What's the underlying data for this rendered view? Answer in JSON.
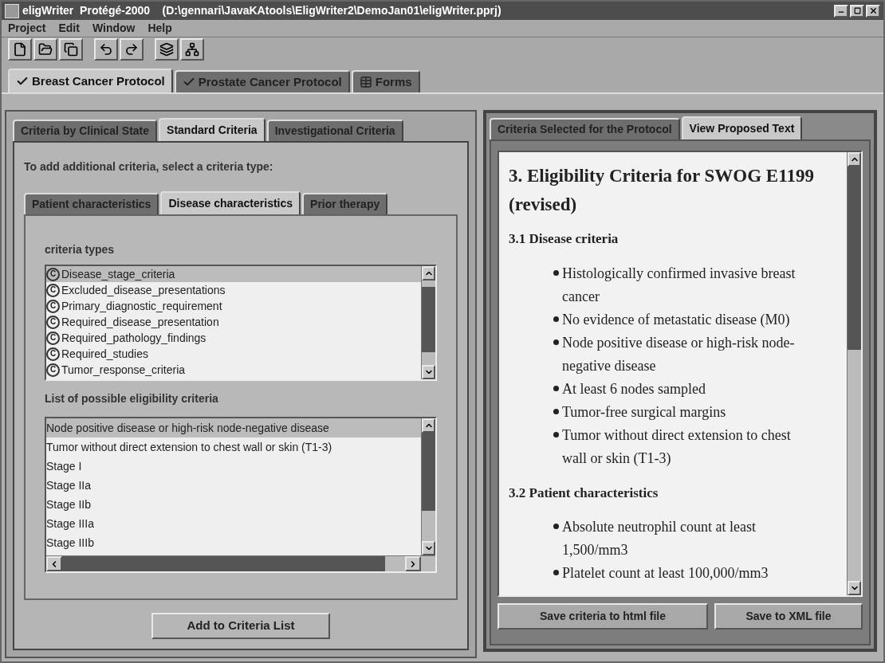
{
  "window": {
    "title": "eligWriter  Protégé-2000    (D:\\gennari\\JavaKAtools\\EligWriter2\\DemoJan01\\eligWriter.pprj)"
  },
  "menu": [
    "Project",
    "Edit",
    "Window",
    "Help"
  ],
  "protocol_tabs": [
    {
      "label": "Breast Cancer Protocol",
      "kind": "check",
      "selected": true
    },
    {
      "label": "Prostate Cancer Protocol",
      "kind": "check",
      "selected": false
    },
    {
      "label": "Forms",
      "kind": "form",
      "selected": false
    }
  ],
  "left_tabs": [
    {
      "label": "Criteria by Clinical State",
      "selected": false
    },
    {
      "label": "Standard Criteria",
      "selected": true
    },
    {
      "label": "Investigational Criteria",
      "selected": false
    }
  ],
  "instruction": "To add additional criteria, select a criteria type:",
  "type_tabs": [
    {
      "label": "Patient characteristics",
      "selected": false
    },
    {
      "label": "Disease characteristics",
      "selected": true
    },
    {
      "label": "Prior therapy",
      "selected": false
    }
  ],
  "criteria_types": {
    "label": "criteria types",
    "items": [
      {
        "icon_letter": "C",
        "label": "Disease_stage_criteria",
        "selected": true
      },
      {
        "icon_letter": "C",
        "label": "Excluded_disease_presentations",
        "selected": false
      },
      {
        "icon_letter": "C",
        "label": "Primary_diagnostic_requirement",
        "selected": false
      },
      {
        "icon_letter": "C",
        "label": "Required_disease_presentation",
        "selected": false
      },
      {
        "icon_letter": "C",
        "label": "Required_pathology_findings",
        "selected": false
      },
      {
        "icon_letter": "C",
        "label": "Required_studies",
        "selected": false
      },
      {
        "icon_letter": "C",
        "label": "Tumor_response_criteria",
        "selected": false
      }
    ]
  },
  "possible_criteria": {
    "label": "List of possible eligibility criteria",
    "items": [
      {
        "label": "Node positive disease or high-risk node-negative disease",
        "selected": true
      },
      {
        "label": "Tumor without direct extension to chest wall or skin (T1-3)",
        "selected": false
      },
      {
        "label": "Stage I",
        "selected": false
      },
      {
        "label": "Stage IIa",
        "selected": false
      },
      {
        "label": "Stage IIb",
        "selected": false
      },
      {
        "label": "Stage IIIa",
        "selected": false
      },
      {
        "label": "Stage IIIb",
        "selected": false
      }
    ]
  },
  "add_button": "Add to Criteria List",
  "right_tabs": [
    {
      "label": "Criteria Selected for the Protocol",
      "selected": false
    },
    {
      "label": "View Proposed Text",
      "selected": true
    }
  ],
  "document": {
    "heading": "3. Eligibility Criteria for SWOG E1199 (revised)",
    "sections": [
      {
        "title": "3.1 Disease criteria",
        "bullets": [
          "Histologically confirmed invasive breast cancer",
          "No evidence of metastatic disease (M0)",
          "Node positive disease or high-risk node-negative disease",
          "At least 6 nodes sampled",
          "Tumor-free surgical margins",
          "Tumor without direct extension to chest wall or skin (T1-3)"
        ]
      },
      {
        "title": "3.2 Patient characteristics",
        "bullets": [
          "Absolute neutrophil count at least 1,500/mm3",
          "Platelet count at least 100,000/mm3"
        ]
      }
    ]
  },
  "buttons": [
    "Save criteria to html file",
    "Save to XML file"
  ]
}
